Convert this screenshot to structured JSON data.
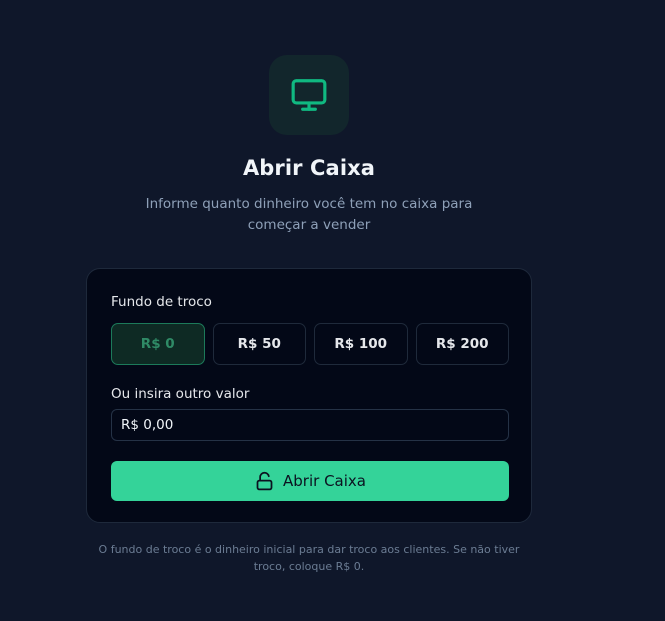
{
  "header": {
    "icon": "monitor-icon",
    "title": "Abrir Caixa",
    "subtitle": "Informe quanto dinheiro você tem no caixa para começar a vender"
  },
  "form": {
    "fundo_label": "Fundo de troco",
    "presets": [
      {
        "label": "R$ 0",
        "selected": true
      },
      {
        "label": "R$ 50",
        "selected": false
      },
      {
        "label": "R$ 100",
        "selected": false
      },
      {
        "label": "R$ 200",
        "selected": false
      }
    ],
    "custom_label": "Ou insira outro valor",
    "custom_value": "R$ 0,00",
    "submit_icon": "unlock-icon",
    "submit_label": "Abrir Caixa"
  },
  "footnote": "O fundo de troco é o dinheiro inicial para dar troco aos clientes. Se não tiver troco, coloque R$ 0.",
  "colors": {
    "background": "#0f172a",
    "card": "#030817",
    "accent": "#34d399",
    "icon_accent": "#10b981"
  }
}
